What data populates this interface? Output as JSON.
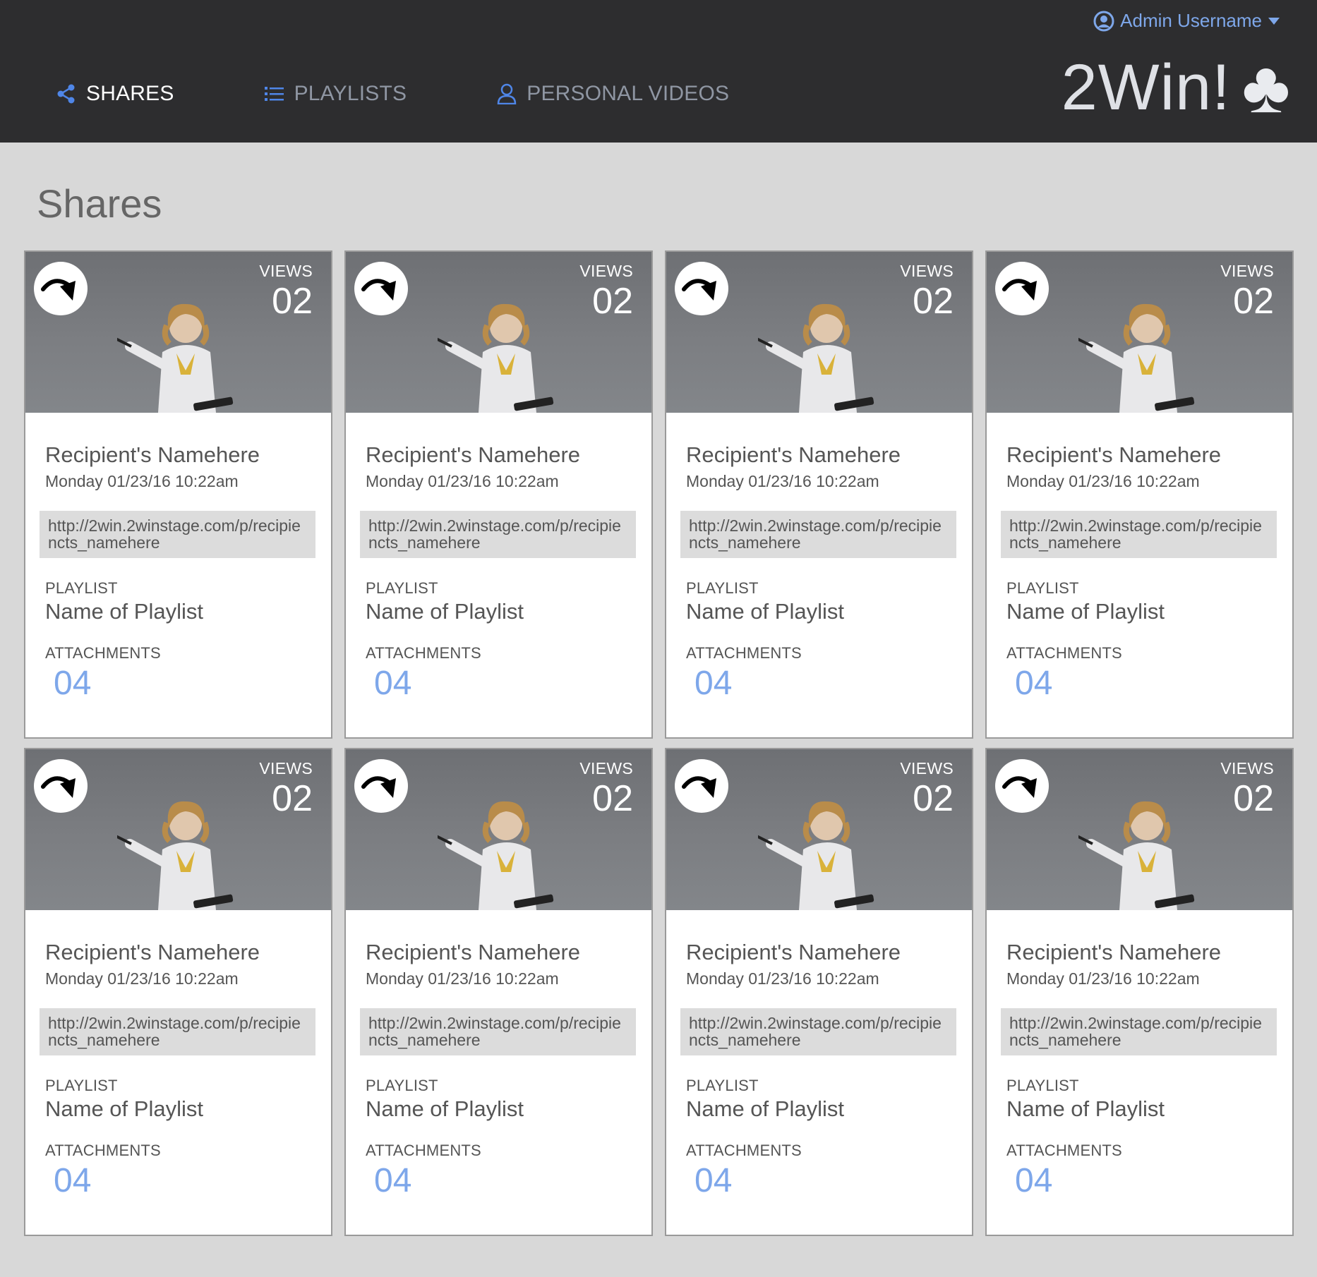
{
  "header": {
    "user_name": "Admin Username",
    "brand": "2Win!",
    "brand_icon": "♣",
    "nav": [
      {
        "label": "SHARES",
        "icon": "share-icon",
        "active": true
      },
      {
        "label": "PLAYLISTS",
        "icon": "list-icon",
        "active": false
      },
      {
        "label": "PERSONAL VIDEOS",
        "icon": "user-icon",
        "active": false
      }
    ]
  },
  "page": {
    "title": "Shares"
  },
  "colors": {
    "accent": "#7ea7ea",
    "topbar": "#2d2d2f",
    "background": "#d8d8d8"
  },
  "labels": {
    "views": "VIEWS",
    "playlist": "PLAYLIST",
    "attachments": "ATTACHMENTS"
  },
  "cards": [
    {
      "views": "02",
      "recipient": "Recipient's Namehere",
      "date": "Monday 01/23/16 10:22am",
      "link": "http://2win.2winstage.com/p/recipiencts_namehere",
      "playlist": "Name of Playlist",
      "attachments": "04"
    },
    {
      "views": "02",
      "recipient": "Recipient's Namehere",
      "date": "Monday 01/23/16 10:22am",
      "link": "http://2win.2winstage.com/p/recipiencts_namehere",
      "playlist": "Name of Playlist",
      "attachments": "04"
    },
    {
      "views": "02",
      "recipient": "Recipient's Namehere",
      "date": "Monday 01/23/16 10:22am",
      "link": "http://2win.2winstage.com/p/recipiencts_namehere",
      "playlist": "Name of Playlist",
      "attachments": "04"
    },
    {
      "views": "02",
      "recipient": "Recipient's Namehere",
      "date": "Monday 01/23/16 10:22am",
      "link": "http://2win.2winstage.com/p/recipiencts_namehere",
      "playlist": "Name of Playlist",
      "attachments": "04"
    },
    {
      "views": "02",
      "recipient": "Recipient's Namehere",
      "date": "Monday 01/23/16 10:22am",
      "link": "http://2win.2winstage.com/p/recipiencts_namehere",
      "playlist": "Name of Playlist",
      "attachments": "04"
    },
    {
      "views": "02",
      "recipient": "Recipient's Namehere",
      "date": "Monday 01/23/16 10:22am",
      "link": "http://2win.2winstage.com/p/recipiencts_namehere",
      "playlist": "Name of Playlist",
      "attachments": "04"
    },
    {
      "views": "02",
      "recipient": "Recipient's Namehere",
      "date": "Monday 01/23/16 10:22am",
      "link": "http://2win.2winstage.com/p/recipiencts_namehere",
      "playlist": "Name of Playlist",
      "attachments": "04"
    },
    {
      "views": "02",
      "recipient": "Recipient's Namehere",
      "date": "Monday 01/23/16 10:22am",
      "link": "http://2win.2winstage.com/p/recipiencts_namehere",
      "playlist": "Name of Playlist",
      "attachments": "04"
    }
  ]
}
